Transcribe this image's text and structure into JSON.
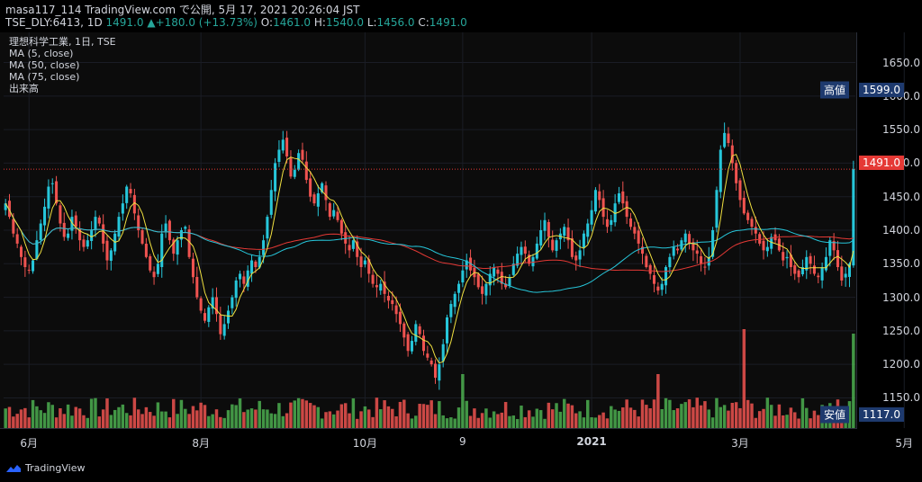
{
  "header": {
    "line1_prefix": "masa117_114 TradingView.com で公開, 5月 17, 2021 20:26:04 JST",
    "symbol": "TSE_DLY:6413, 1D",
    "last": "1491.0",
    "change": "▲+180.0 (+13.73%)",
    "o_label": "O:",
    "o_value": "1461.0",
    "h_label": "H:",
    "h_value": "1540.0",
    "l_label": "L:",
    "l_value": "1456.0",
    "c_label": "C:",
    "c_value": "1491.0"
  },
  "legend": {
    "title": "理想科学工業, 1日, TSE",
    "ma5": "MA (5, close)",
    "ma50": "MA (50, close)",
    "ma75": "MA (75, close)",
    "volume": "出来高"
  },
  "tags": {
    "high_label": "高値",
    "high_value": "1599.0",
    "low_label": "安値",
    "low_value": "1117.0",
    "last_value": "1491.0"
  },
  "footer": {
    "brand": "TradingView"
  },
  "colors": {
    "up": "#26c6da",
    "down": "#ef5350",
    "ma5": "#f0e040",
    "ma50": "#26c6da",
    "ma75": "#e53935",
    "vol_up": "#4caf50",
    "vol_down": "#ef5350",
    "tag_bg": "#1e3a6e",
    "last_bg": "#e53935"
  },
  "chart_data": {
    "type": "candlestick",
    "title": "理想科学工業, 1日, TSE",
    "y_ticks": [
      "1650.0",
      "1600.0",
      "1550.0",
      "1500.0",
      "1450.0",
      "1400.0",
      "1350.0",
      "1300.0",
      "1250.0",
      "1200.0",
      "1150.0"
    ],
    "y_values": [
      1650,
      1600,
      1550,
      1500,
      1450,
      1400,
      1350,
      1300,
      1250,
      1200,
      1150
    ],
    "ylim": [
      1105,
      1695
    ],
    "x_labels": [
      {
        "text": "6月",
        "bold": false
      },
      {
        "text": "8月",
        "bold": false
      },
      {
        "text": "10月",
        "bold": false
      },
      {
        "text": "9",
        "bold": false
      },
      {
        "text": "2021",
        "bold": true
      },
      {
        "text": "3月",
        "bold": false
      },
      {
        "text": "5月",
        "bold": false
      }
    ],
    "x_label_index": [
      6,
      50,
      92,
      117,
      150,
      188,
      230
    ],
    "series": [
      {
        "name": "TSE_DLY:6413",
        "close": [
          1440,
          1420,
          1395,
          1380,
          1360,
          1345,
          1340,
          1355,
          1385,
          1410,
          1435,
          1465,
          1470,
          1440,
          1410,
          1390,
          1395,
          1420,
          1405,
          1385,
          1375,
          1385,
          1400,
          1420,
          1410,
          1380,
          1355,
          1370,
          1395,
          1420,
          1440,
          1465,
          1455,
          1425,
          1400,
          1380,
          1360,
          1340,
          1330,
          1350,
          1395,
          1410,
          1385,
          1365,
          1385,
          1400,
          1405,
          1360,
          1330,
          1300,
          1280,
          1265,
          1285,
          1300,
          1275,
          1245,
          1260,
          1280,
          1300,
          1325,
          1335,
          1320,
          1340,
          1355,
          1345,
          1360,
          1385,
          1420,
          1460,
          1500,
          1520,
          1535,
          1510,
          1480,
          1490,
          1515,
          1505,
          1475,
          1450,
          1440,
          1455,
          1470,
          1445,
          1420,
          1430,
          1415,
          1395,
          1380,
          1370,
          1385,
          1360,
          1345,
          1355,
          1335,
          1320,
          1315,
          1320,
          1305,
          1295,
          1290,
          1275,
          1260,
          1240,
          1220,
          1235,
          1260,
          1245,
          1220,
          1210,
          1200,
          1180,
          1200,
          1230,
          1270,
          1290,
          1305,
          1320,
          1340,
          1355,
          1340,
          1330,
          1315,
          1305,
          1320,
          1335,
          1345,
          1335,
          1320,
          1315,
          1330,
          1350,
          1365,
          1375,
          1365,
          1350,
          1360,
          1380,
          1400,
          1415,
          1390,
          1370,
          1385,
          1395,
          1405,
          1385,
          1360,
          1355,
          1370,
          1395,
          1410,
          1430,
          1460,
          1445,
          1420,
          1405,
          1415,
          1440,
          1455,
          1440,
          1420,
          1405,
          1395,
          1380,
          1365,
          1345,
          1335,
          1320,
          1310,
          1320,
          1345,
          1360,
          1375,
          1370,
          1385,
          1395,
          1380,
          1370,
          1365,
          1350,
          1345,
          1360,
          1400,
          1460,
          1520,
          1545,
          1530,
          1500,
          1470,
          1445,
          1425,
          1415,
          1405,
          1395,
          1380,
          1370,
          1375,
          1390,
          1385,
          1370,
          1355,
          1360,
          1345,
          1335,
          1330,
          1345,
          1360,
          1350,
          1335,
          1330,
          1345,
          1360,
          1385,
          1370,
          1345,
          1325,
          1335,
          1350,
          1491
        ]
      }
    ]
  }
}
